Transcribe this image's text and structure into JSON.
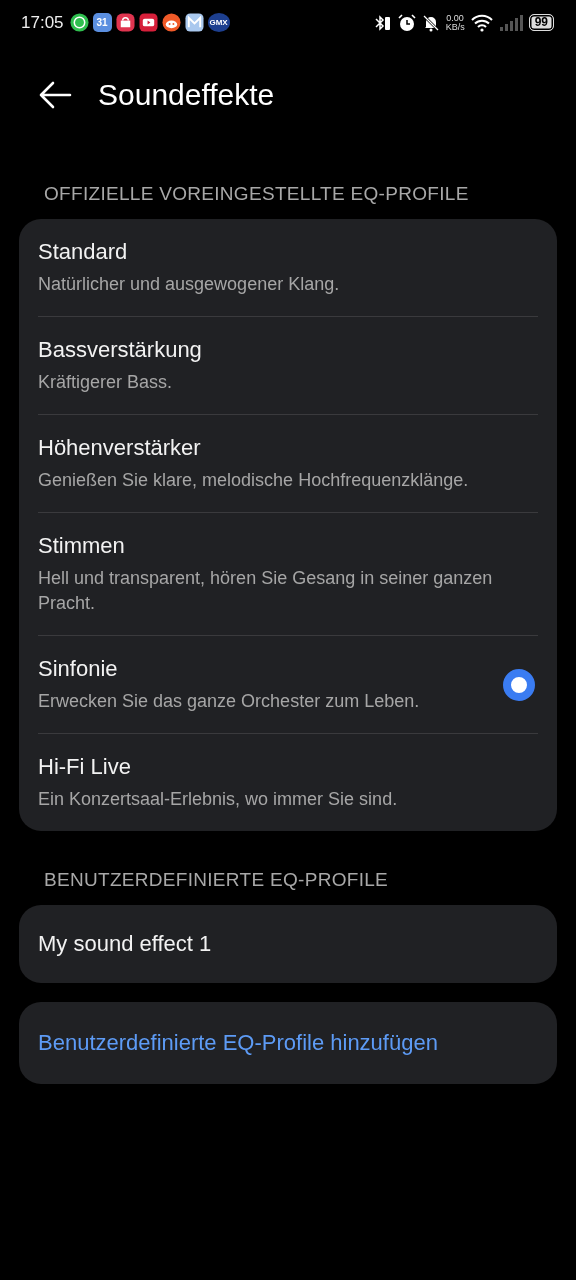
{
  "status_bar": {
    "time": "17:05",
    "calendar_day": "31",
    "mail_label": "GMX",
    "net_speed": "0.00",
    "net_unit": "KB/s",
    "battery": "99"
  },
  "header": {
    "title": "Soundeffekte"
  },
  "sections": [
    {
      "heading": "OFFIZIELLE VOREINGESTELLTE EQ-PROFILE",
      "items": [
        {
          "title": "Standard",
          "subtitle": "Natürlicher und ausgewogener Klang.",
          "selected": false
        },
        {
          "title": "Bassverstärkung",
          "subtitle": "Kräftigerer Bass.",
          "selected": false
        },
        {
          "title": "Höhenverstärker",
          "subtitle": "Genießen Sie klare, melodische Hochfrequenzklänge.",
          "selected": false
        },
        {
          "title": "Stimmen",
          "subtitle": "Hell und transparent, hören Sie Gesang in seiner ganzen Pracht.",
          "selected": false
        },
        {
          "title": "Sinfonie",
          "subtitle": "Erwecken Sie das ganze Orchester zum Leben.",
          "selected": true
        },
        {
          "title": "Hi-Fi Live",
          "subtitle": "Ein Konzertsaal-Erlebnis, wo immer Sie sind.",
          "selected": false
        }
      ]
    },
    {
      "heading": "BENUTZERDEFINIERTE EQ-PROFILE",
      "items": [
        {
          "title": "My sound effect 1",
          "selected": false
        }
      ]
    }
  ],
  "add_button": {
    "label": "Benutzerdefinierte EQ-Profile hinzufügen"
  }
}
